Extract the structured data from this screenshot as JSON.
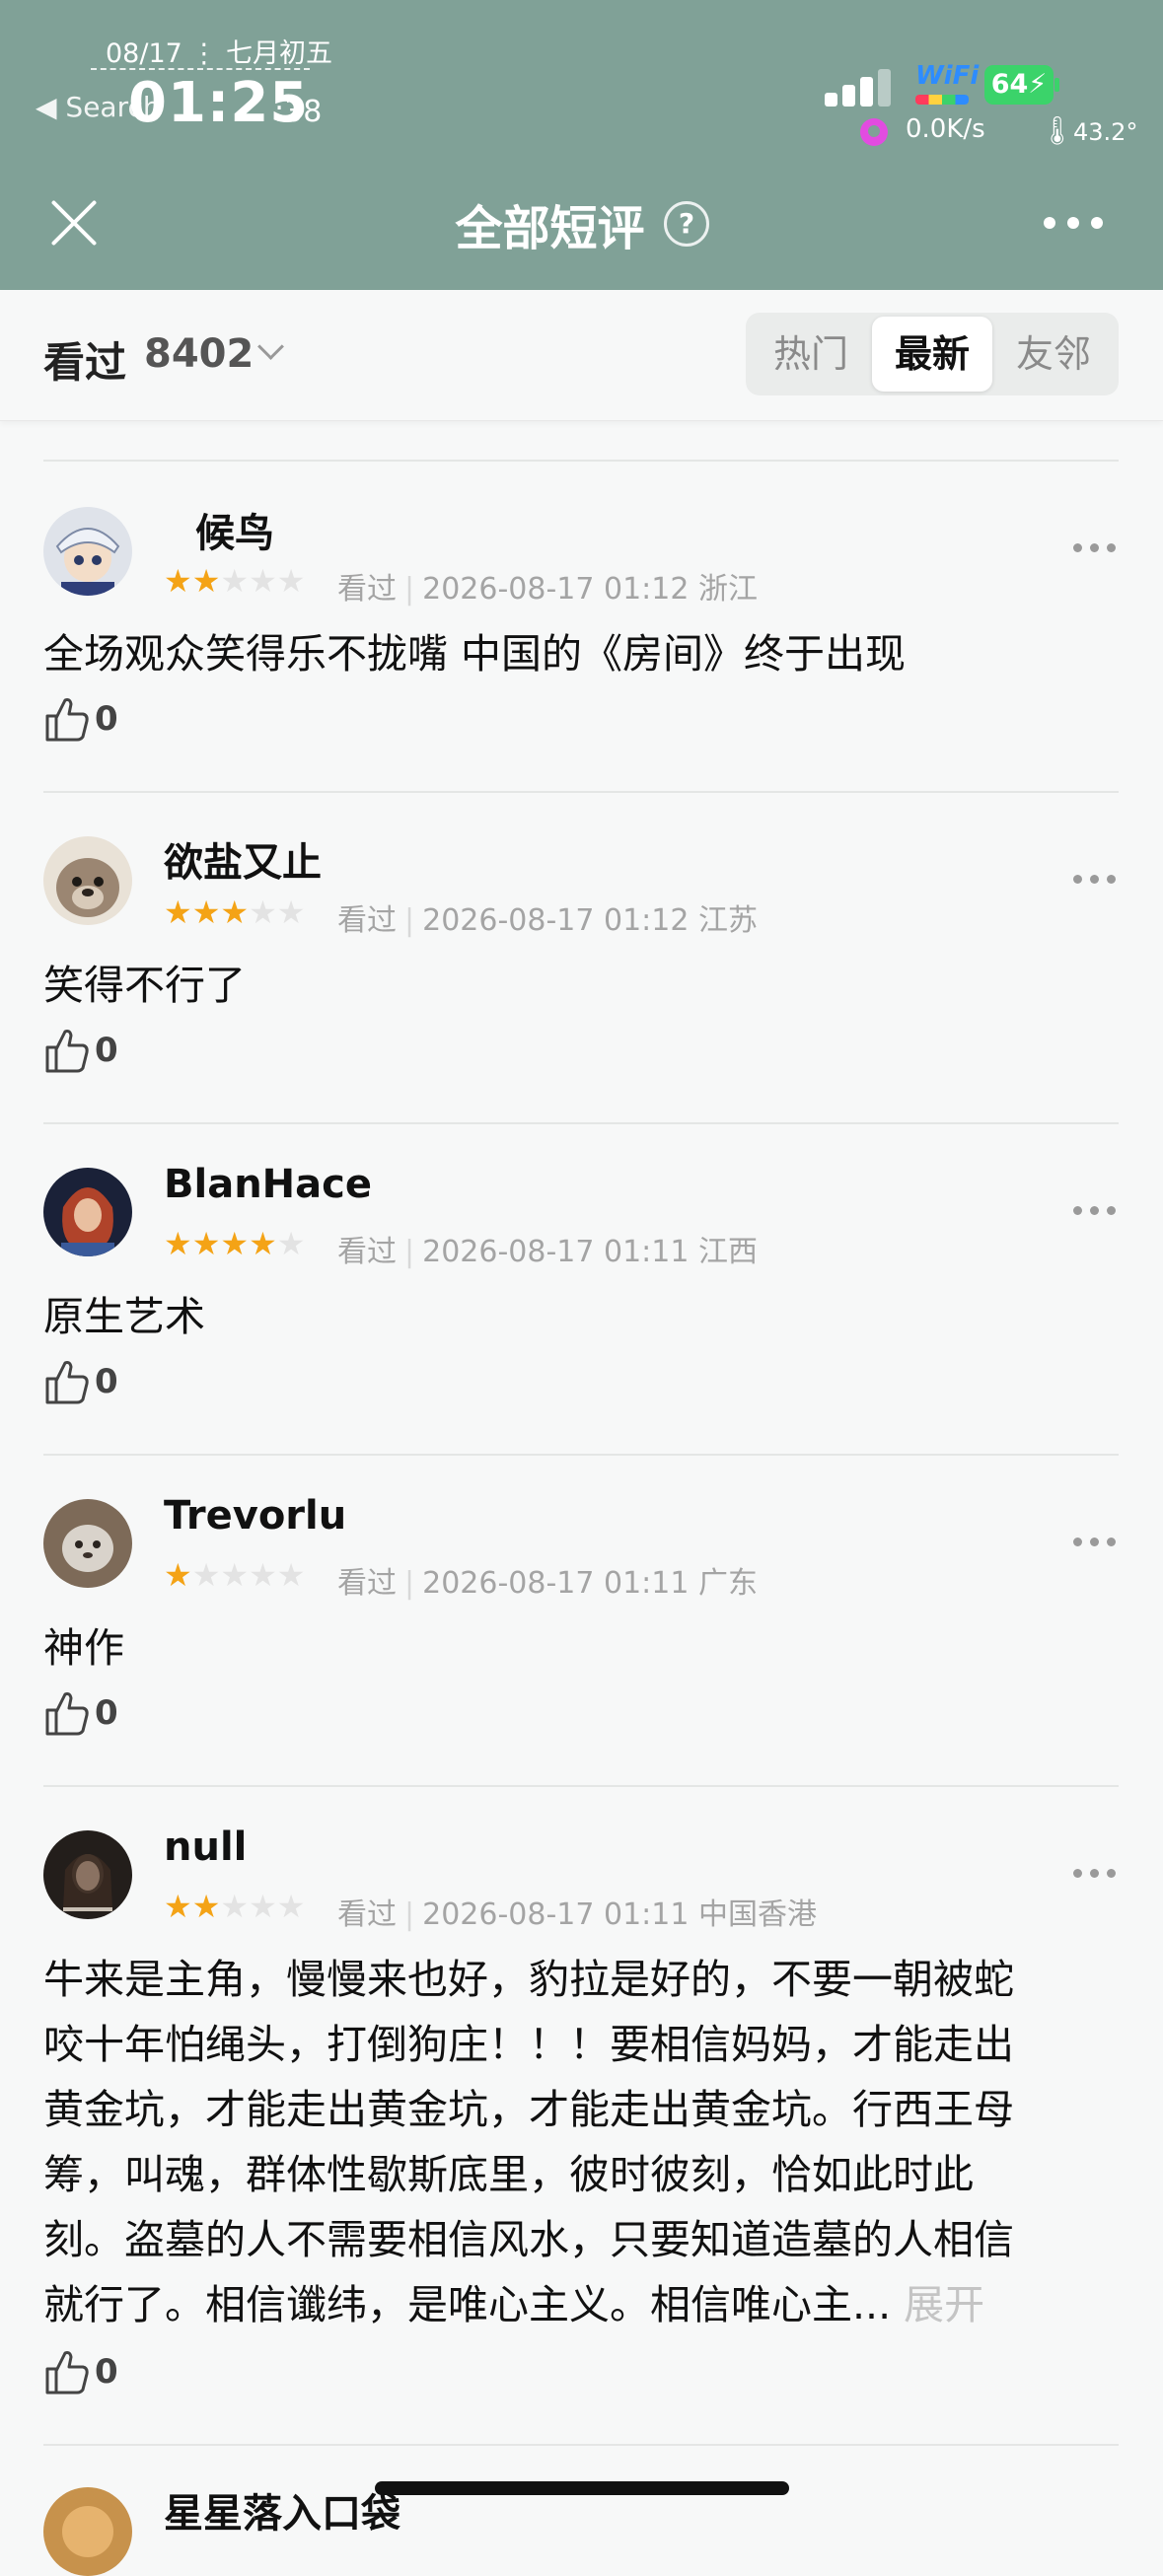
{
  "status_bar": {
    "date": "08/17 ⋮ 七月初五",
    "back_label": "◀ Search",
    "time": "01:25",
    "seconds": ":38",
    "wifi_label": "WiFi",
    "battery": "64",
    "net_speed": "0.0K/s",
    "temperature": "43.2°"
  },
  "header": {
    "title": "全部短评",
    "help_glyph": "?"
  },
  "filter": {
    "count_label": "看过",
    "count_value": "8402",
    "tabs": [
      {
        "label": "热门",
        "active": false
      },
      {
        "label": "最新",
        "active": true
      },
      {
        "label": "友邻",
        "active": false
      }
    ]
  },
  "reviews": [
    {
      "user": "候鸟",
      "rating": 2,
      "status": "看过",
      "date": "2026-08-17 01:12",
      "location": "浙江",
      "text": "全场观众笑得乐不拢嘴 中国的《房间》终于出现",
      "likes": "0",
      "avatar_color": "#d9dde6"
    },
    {
      "user": "欲盐又止",
      "rating": 3,
      "status": "看过",
      "date": "2026-08-17 01:12",
      "location": "江苏",
      "text": "笑得不行了",
      "likes": "0",
      "avatar_color": "#a89886"
    },
    {
      "user": "BlanHace",
      "rating": 4,
      "status": "看过",
      "date": "2026-08-17 01:11",
      "location": "江西",
      "text": "原生艺术",
      "likes": "0",
      "avatar_color": "#2a3550"
    },
    {
      "user": "Trevorlu",
      "rating": 1,
      "status": "看过",
      "date": "2026-08-17 01:11",
      "location": "广东",
      "text": "神作",
      "likes": "0",
      "avatar_color": "#8a7864"
    },
    {
      "user": "null",
      "rating": 2,
      "status": "看过",
      "date": "2026-08-17 01:11",
      "location": "中国香港",
      "text_lines": [
        "牛来是主角，慢慢来也好，豹拉是好的，不要一朝被蛇",
        "咬十年怕绳头，打倒狗庄！！！要相信妈妈，才能走出",
        "黄金坑，才能走出黄金坑，才能走出黄金坑。行西王母",
        "筹，叫魂，群体性歇斯底里，彼时彼刻，恰如此时此",
        "刻。盗墓的人不需要相信风水，只要知道造墓的人相信",
        "就行了。相信谶纬，是唯心主义。相信唯心主..."
      ],
      "expand_label": "展开",
      "likes": "0",
      "avatar_color": "#2b2520"
    },
    {
      "user": "星星落入口袋",
      "avatar_color": "#b07a3a"
    }
  ]
}
